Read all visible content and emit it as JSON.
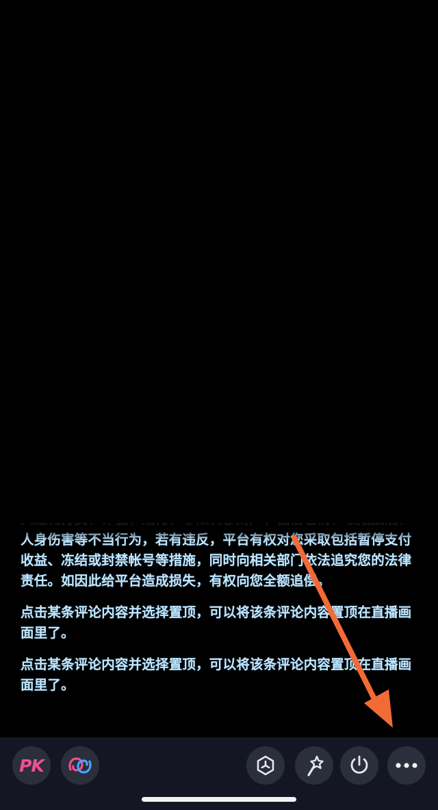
{
  "feed": {
    "messages": [
      "人送礼打赏、诈骗、赌博、非法转移财产、低俗色情、吸烟酗酒、人身伤害等不当行为，若有违反，平台有权对您采取包括暂停支付收益、冻结或封禁帐号等措施，同时向相关部门依法追究您的法律责任。如因此给平台造成损失，有权向您全额追偿。",
      "点击某条评论内容并选择置顶，可以将该条评论内容置顶在直播画面里了。",
      "点击某条评论内容并选择置顶，可以将该条评论内容置顶在直播画面里了。"
    ]
  },
  "toolbar": {
    "pk_label": "PK",
    "buttons": [
      {
        "name": "pk-button",
        "icon": "pk-icon"
      },
      {
        "name": "link-mic-button",
        "icon": "link-mic-icon"
      },
      {
        "name": "interaction-button",
        "icon": "hexagon-icon"
      },
      {
        "name": "beauty-button",
        "icon": "magic-wand-icon"
      },
      {
        "name": "live-ops-button",
        "icon": "power-icon"
      },
      {
        "name": "more-button",
        "icon": "more-dots-icon"
      }
    ]
  },
  "colors": {
    "message_text": "#bfe6ff",
    "toolbar_bg": "#141723",
    "button_bg": "#2b2f3b",
    "pk_pink": "#f0508f",
    "annotation_arrow": "#f26a36"
  }
}
